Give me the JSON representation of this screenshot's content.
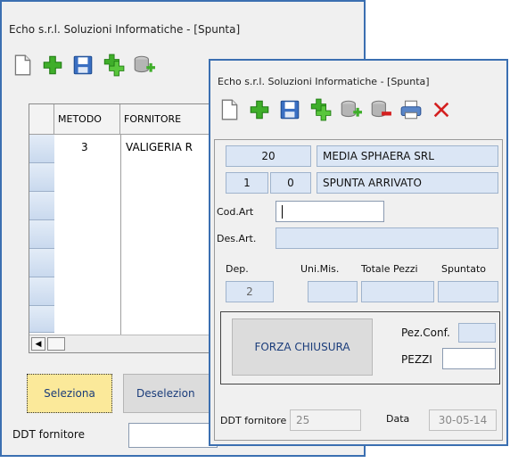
{
  "back_window": {
    "title": "Echo s.r.l. Soluzioni Informatiche - [Spunta]",
    "grid": {
      "columns": [
        "METODO",
        "FORNITORE"
      ],
      "rows": [
        {
          "metodo": "3",
          "fornitore": "VALIGERIA R"
        }
      ]
    },
    "seleziona_label": "Seleziona",
    "deseleziona_label": "Deselezion",
    "ddt_fornitore_label": "DDT fornitore"
  },
  "front_window": {
    "title": "Echo s.r.l. Soluzioni Informatiche - [Spunta]",
    "fornitore_code": "20",
    "fornitore_name": "MEDIA SPHAERA SRL",
    "stato_num1": "1",
    "stato_num2": "0",
    "stato_label": "SPUNTA ARRIVATO",
    "cod_art_label": "Cod.Art",
    "cod_art_value": "",
    "des_art_label": "Des.Art.",
    "des_art_value": "",
    "dep_label": "Dep.",
    "dep_value": "2",
    "uni_mis_label": "Uni.Mis.",
    "totale_pezzi_label": "Totale Pezzi",
    "spuntato_label": "Spuntato",
    "forza_chiusura_label": "FORZA CHIUSURA",
    "pez_conf_label": "Pez.Conf.",
    "pezzi_label": "PEZZI",
    "ddt_fornitore_label": "DDT fornitore",
    "ddt_fornitore_value": "25",
    "data_label": "Data",
    "data_value": "30-05-14"
  },
  "toolbar_icons": [
    "new-document-icon",
    "add-icon",
    "save-icon",
    "add-multiple-icon",
    "database-add-icon",
    "database-remove-icon",
    "print-icon",
    "close-icon"
  ],
  "colors": {
    "window_border": "#3b6fb1",
    "field_bg": "#dbe6f5",
    "button_text": "#1a3c7a",
    "green": "#3fae2a",
    "red": "#d42020"
  }
}
